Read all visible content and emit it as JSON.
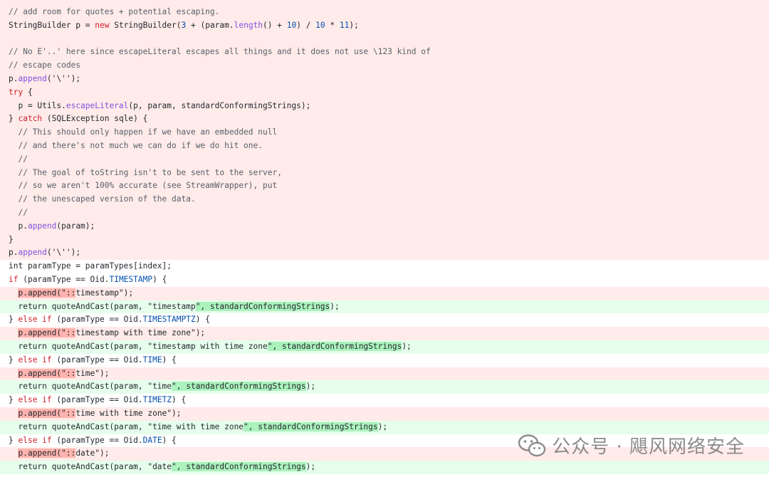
{
  "watermark": {
    "text": "公众号 · 飓风网络安全",
    "icon": "wechat-icon"
  },
  "colors": {
    "deleted_bg": "#ffebe9",
    "added_bg": "#e6ffec",
    "deleted_highlight": "#ffb3ae",
    "added_highlight": "#abf2bc",
    "comment": "#57606a",
    "keyword": "#cf222e",
    "method": "#8250df",
    "number": "#0550ae",
    "string": "#0a3069"
  },
  "lines": [
    {
      "type": "del",
      "tokens": [
        {
          "t": "// add room for quotes + potential escaping.",
          "c": "cm"
        }
      ]
    },
    {
      "type": "del",
      "tokens": [
        {
          "t": "StringBuilder p = "
        },
        {
          "t": "new",
          "c": "kw"
        },
        {
          "t": " StringBuilder("
        },
        {
          "t": "3",
          "c": "num"
        },
        {
          "t": " + (param."
        },
        {
          "t": "length",
          "c": "fn"
        },
        {
          "t": "() + "
        },
        {
          "t": "10",
          "c": "num"
        },
        {
          "t": ") / "
        },
        {
          "t": "10",
          "c": "num"
        },
        {
          "t": " * "
        },
        {
          "t": "11",
          "c": "num"
        },
        {
          "t": ");"
        }
      ]
    },
    {
      "type": "del",
      "tokens": []
    },
    {
      "type": "del",
      "tokens": [
        {
          "t": "// No E'..' here since escapeLiteral escapes all things and it does not use \\123 kind of",
          "c": "cm"
        }
      ]
    },
    {
      "type": "del",
      "tokens": [
        {
          "t": "// escape codes",
          "c": "cm"
        }
      ]
    },
    {
      "type": "del",
      "tokens": [
        {
          "t": "p."
        },
        {
          "t": "append",
          "c": "fn"
        },
        {
          "t": "('\\'');"
        }
      ]
    },
    {
      "type": "del",
      "tokens": [
        {
          "t": "try",
          "c": "kw"
        },
        {
          "t": " {"
        }
      ]
    },
    {
      "type": "del",
      "tokens": [
        {
          "t": "  p = Utils."
        },
        {
          "t": "escapeLiteral",
          "c": "fn"
        },
        {
          "t": "(p, param, standardConformingStrings);"
        }
      ]
    },
    {
      "type": "del",
      "tokens": [
        {
          "t": "} "
        },
        {
          "t": "catch",
          "c": "kw"
        },
        {
          "t": " (SQLException sqle) {"
        }
      ]
    },
    {
      "type": "del",
      "tokens": [
        {
          "t": "  "
        },
        {
          "t": "// This should only happen if we have an embedded null",
          "c": "cm"
        }
      ]
    },
    {
      "type": "del",
      "tokens": [
        {
          "t": "  "
        },
        {
          "t": "// and there's not much we can do if we do hit one.",
          "c": "cm"
        }
      ]
    },
    {
      "type": "del",
      "tokens": [
        {
          "t": "  "
        },
        {
          "t": "//",
          "c": "cm"
        }
      ]
    },
    {
      "type": "del",
      "tokens": [
        {
          "t": "  "
        },
        {
          "t": "// The goal of toString isn't to be sent to the server,",
          "c": "cm"
        }
      ]
    },
    {
      "type": "del",
      "tokens": [
        {
          "t": "  "
        },
        {
          "t": "// so we aren't 100% accurate (see StreamWrapper), put",
          "c": "cm"
        }
      ]
    },
    {
      "type": "del",
      "tokens": [
        {
          "t": "  "
        },
        {
          "t": "// the unescaped version of the data.",
          "c": "cm"
        }
      ]
    },
    {
      "type": "del",
      "tokens": [
        {
          "t": "  "
        },
        {
          "t": "//",
          "c": "cm"
        }
      ]
    },
    {
      "type": "del",
      "tokens": [
        {
          "t": "  p."
        },
        {
          "t": "append",
          "c": "fn"
        },
        {
          "t": "(param);"
        }
      ]
    },
    {
      "type": "del",
      "tokens": [
        {
          "t": "}"
        }
      ]
    },
    {
      "type": "del",
      "tokens": [
        {
          "t": "p."
        },
        {
          "t": "append",
          "c": "fn"
        },
        {
          "t": "('\\'');"
        }
      ]
    },
    {
      "type": "ctx",
      "tokens": [
        {
          "t": "int paramType = paramTypes[index];"
        }
      ]
    },
    {
      "type": "ctx",
      "tokens": [
        {
          "t": "if",
          "c": "kw"
        },
        {
          "t": " (paramType == Oid."
        },
        {
          "t": "TIMESTAMP",
          "c": "const"
        },
        {
          "t": ") {"
        }
      ]
    },
    {
      "type": "del",
      "tokens": [
        {
          "t": "  "
        },
        {
          "t": "p.append(\"::",
          "h": "hl-del"
        },
        {
          "t": "timestamp\");"
        }
      ]
    },
    {
      "type": "add",
      "tokens": [
        {
          "t": "  return quoteAndCast(param, \"timestamp"
        },
        {
          "t": "\", standardConformingStrings",
          "h": "hl-add"
        },
        {
          "t": ");"
        }
      ]
    },
    {
      "type": "ctx",
      "tokens": [
        {
          "t": "} "
        },
        {
          "t": "else if",
          "c": "kw"
        },
        {
          "t": " (paramType == Oid."
        },
        {
          "t": "TIMESTAMPTZ",
          "c": "const"
        },
        {
          "t": ") {"
        }
      ]
    },
    {
      "type": "del",
      "tokens": [
        {
          "t": "  "
        },
        {
          "t": "p.append(\"::",
          "h": "hl-del"
        },
        {
          "t": "timestamp with time zone\");"
        }
      ]
    },
    {
      "type": "add",
      "tokens": [
        {
          "t": "  return quoteAndCast(param, \"timestamp with time zone"
        },
        {
          "t": "\", standardConformingStrings",
          "h": "hl-add"
        },
        {
          "t": ");"
        }
      ]
    },
    {
      "type": "ctx",
      "tokens": [
        {
          "t": "} "
        },
        {
          "t": "else if",
          "c": "kw"
        },
        {
          "t": " (paramType == Oid."
        },
        {
          "t": "TIME",
          "c": "const"
        },
        {
          "t": ") {"
        }
      ]
    },
    {
      "type": "del",
      "tokens": [
        {
          "t": "  "
        },
        {
          "t": "p.append(\"::",
          "h": "hl-del"
        },
        {
          "t": "time\");"
        }
      ]
    },
    {
      "type": "add",
      "tokens": [
        {
          "t": "  return quoteAndCast(param, \"time"
        },
        {
          "t": "\", standardConformingStrings",
          "h": "hl-add"
        },
        {
          "t": ");"
        }
      ]
    },
    {
      "type": "ctx",
      "tokens": [
        {
          "t": "} "
        },
        {
          "t": "else if",
          "c": "kw"
        },
        {
          "t": " (paramType == Oid."
        },
        {
          "t": "TIMETZ",
          "c": "const"
        },
        {
          "t": ") {"
        }
      ]
    },
    {
      "type": "del",
      "tokens": [
        {
          "t": "  "
        },
        {
          "t": "p.append(\"::",
          "h": "hl-del"
        },
        {
          "t": "time with time zone\");"
        }
      ]
    },
    {
      "type": "add",
      "tokens": [
        {
          "t": "  return quoteAndCast(param, \"time with time zone"
        },
        {
          "t": "\", standardConformingStrings",
          "h": "hl-add"
        },
        {
          "t": ");"
        }
      ]
    },
    {
      "type": "ctx",
      "tokens": [
        {
          "t": "} "
        },
        {
          "t": "else if",
          "c": "kw"
        },
        {
          "t": " (paramType == Oid."
        },
        {
          "t": "DATE",
          "c": "const"
        },
        {
          "t": ") {"
        }
      ]
    },
    {
      "type": "del",
      "tokens": [
        {
          "t": "  "
        },
        {
          "t": "p.append(\"::",
          "h": "hl-del"
        },
        {
          "t": "date\");"
        }
      ]
    },
    {
      "type": "add",
      "tokens": [
        {
          "t": "  return quoteAndCast(param, \"date"
        },
        {
          "t": "\", standardConformingStrings",
          "h": "hl-add"
        },
        {
          "t": ");"
        }
      ]
    }
  ]
}
